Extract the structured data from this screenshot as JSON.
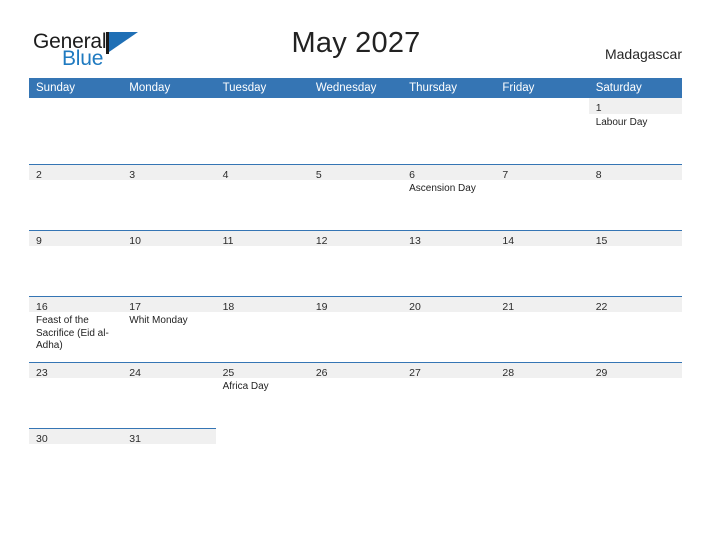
{
  "brand": {
    "name_part1": "General",
    "name_part2": "Blue",
    "flag_icon": "flag-triangle-icon",
    "accent_color": "#1f7ac0"
  },
  "header": {
    "title": "May 2027",
    "country": "Madagascar"
  },
  "calendar": {
    "header_bg": "#3575b4",
    "band_bg": "#f0f0f0",
    "weekdays": [
      "Sunday",
      "Monday",
      "Tuesday",
      "Wednesday",
      "Thursday",
      "Friday",
      "Saturday"
    ],
    "weeks": [
      {
        "days": [
          {
            "num": "",
            "holiday": ""
          },
          {
            "num": "",
            "holiday": ""
          },
          {
            "num": "",
            "holiday": ""
          },
          {
            "num": "",
            "holiday": ""
          },
          {
            "num": "",
            "holiday": ""
          },
          {
            "num": "",
            "holiday": ""
          },
          {
            "num": "1",
            "holiday": "Labour Day"
          }
        ]
      },
      {
        "days": [
          {
            "num": "2",
            "holiday": ""
          },
          {
            "num": "3",
            "holiday": ""
          },
          {
            "num": "4",
            "holiday": ""
          },
          {
            "num": "5",
            "holiday": ""
          },
          {
            "num": "6",
            "holiday": "Ascension Day"
          },
          {
            "num": "7",
            "holiday": ""
          },
          {
            "num": "8",
            "holiday": ""
          }
        ]
      },
      {
        "days": [
          {
            "num": "9",
            "holiday": ""
          },
          {
            "num": "10",
            "holiday": ""
          },
          {
            "num": "11",
            "holiday": ""
          },
          {
            "num": "12",
            "holiday": ""
          },
          {
            "num": "13",
            "holiday": ""
          },
          {
            "num": "14",
            "holiday": ""
          },
          {
            "num": "15",
            "holiday": ""
          }
        ]
      },
      {
        "days": [
          {
            "num": "16",
            "holiday": "Feast of the Sacrifice (Eid al-Adha)"
          },
          {
            "num": "17",
            "holiday": "Whit Monday"
          },
          {
            "num": "18",
            "holiday": ""
          },
          {
            "num": "19",
            "holiday": ""
          },
          {
            "num": "20",
            "holiday": ""
          },
          {
            "num": "21",
            "holiday": ""
          },
          {
            "num": "22",
            "holiday": ""
          }
        ]
      },
      {
        "days": [
          {
            "num": "23",
            "holiday": ""
          },
          {
            "num": "24",
            "holiday": ""
          },
          {
            "num": "25",
            "holiday": "Africa Day"
          },
          {
            "num": "26",
            "holiday": ""
          },
          {
            "num": "27",
            "holiday": ""
          },
          {
            "num": "28",
            "holiday": ""
          },
          {
            "num": "29",
            "holiday": ""
          }
        ]
      },
      {
        "days": [
          {
            "num": "30",
            "holiday": ""
          },
          {
            "num": "31",
            "holiday": ""
          },
          {
            "num": "",
            "holiday": ""
          },
          {
            "num": "",
            "holiday": ""
          },
          {
            "num": "",
            "holiday": ""
          },
          {
            "num": "",
            "holiday": ""
          },
          {
            "num": "",
            "holiday": ""
          }
        ]
      }
    ]
  }
}
